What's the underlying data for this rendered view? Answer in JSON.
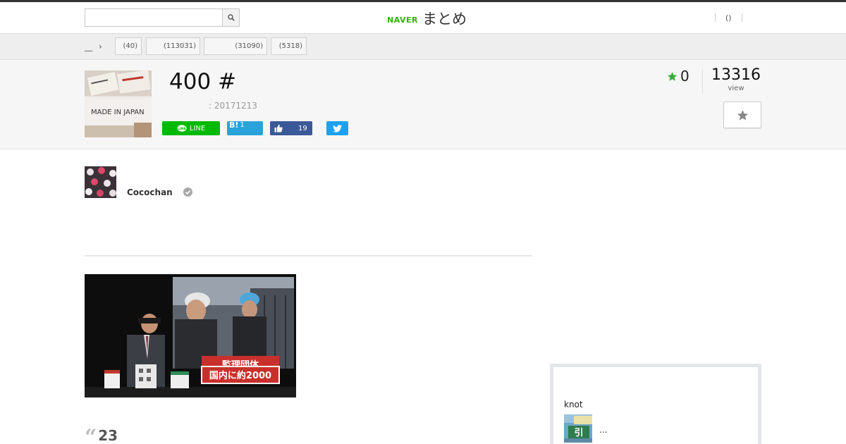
{
  "header": {
    "search_placeholder": "",
    "logo_naver": "NAVER",
    "logo_matome": "まとめ",
    "user_link": "()"
  },
  "categories": {
    "home_label": "__",
    "chips": [
      "(40)",
      "(113031)",
      "(31090)",
      "(5318)"
    ]
  },
  "article": {
    "title": "400 #",
    "updated": ": 20171213",
    "favorite_count": "0",
    "view_count": "13316",
    "view_label": "view",
    "thumbnail_text": "MADE IN JAPAN"
  },
  "share": {
    "line_label": "LINE",
    "hatena_label": "B!",
    "hatena_count": "1",
    "facebook_count": "19"
  },
  "author": {
    "name": "Cocochan"
  },
  "content": {
    "image_caption_line1": "監理団体",
    "image_caption_line2": "国内に約2000",
    "quote_number": "23"
  },
  "sidebar": {
    "title": "knot",
    "item_text": "..."
  },
  "colors": {
    "brand_green": "#2db400",
    "line_green": "#00b900",
    "hatena_blue": "#29a3d9",
    "facebook_blue": "#3b5998",
    "twitter_blue": "#1da1f2",
    "star_green": "#3bab3b"
  }
}
